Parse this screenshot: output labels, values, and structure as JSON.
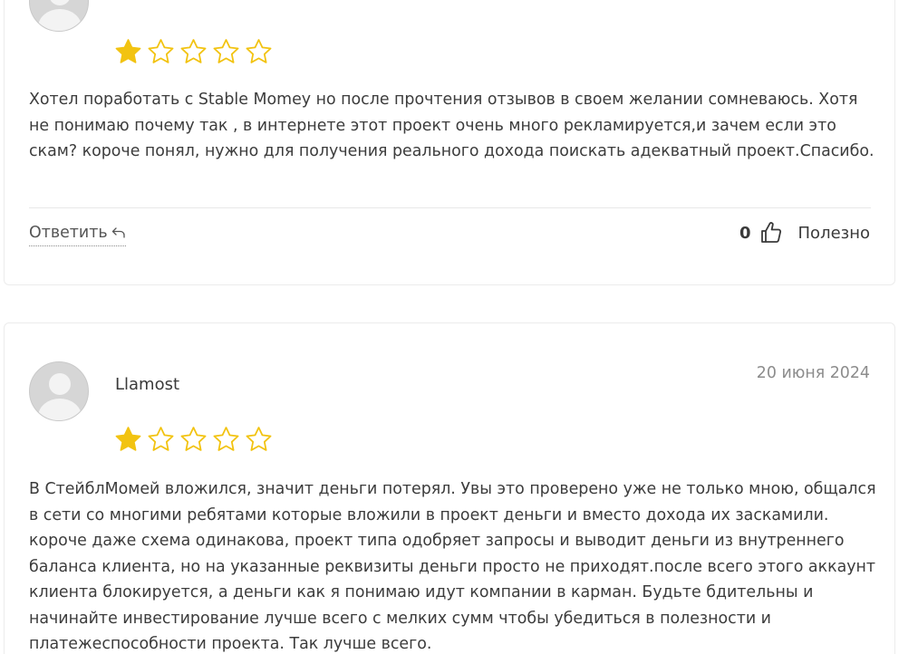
{
  "reviews": [
    {
      "rating": 1,
      "max_rating": 5,
      "text": "Хотел поработать с Stable Momey но после прочтения отзывов в своем желании сомневаюсь. Хотя не понимаю почему так , в интернете этот проект очень много рекламируется,и зачем если это скам? короче понял, нужно для получения реального дохода поискать адекватный проект.Спасибо.",
      "reply_label": "Ответить",
      "vote_count": "0",
      "helpful_label": "Полезно"
    },
    {
      "author": "Llamost",
      "date": "20 июня 2024",
      "rating": 1,
      "max_rating": 5,
      "text": "В СтейблМомей вложился, значит деньги потерял. Увы это проверено уже не только мною, общался в сети со многими ребятами которые вложили в проект деньги и вместо дохода их заскамили. короче даже схема одинакова, проект типа одобряет запросы и выводит деньги из внутреннего баланса клиента, но на указанные реквизиты деньги просто не приходят.после всего этого аккаунт клиента блокируется, а деньги как я понимаю идут компании в карман. Будьте бдительны и начинайте инвестирование лучше всего с мелких сумм чтобы убедиться в полезности и платежеспособности проекта. Так лучше всего."
    }
  ],
  "colors": {
    "star_filled": "#f2c311",
    "star_empty_stroke": "#f2c311",
    "date_text": "#8c8c8c",
    "card_border": "#ececec"
  },
  "icons": {
    "avatar": "default-user-avatar",
    "reply": "reply-arrow-icon",
    "like": "thumbs-up-icon",
    "star": "star-icon"
  }
}
